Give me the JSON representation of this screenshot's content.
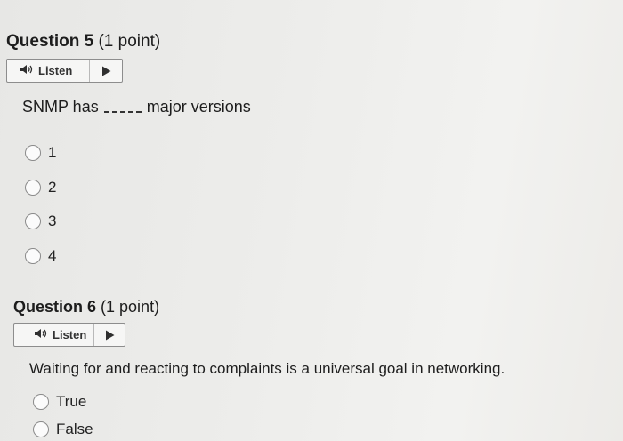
{
  "questions": [
    {
      "number_label": "Question 5",
      "points_label": "(1 point)",
      "listen_label": "Listen",
      "prompt_before": "SNMP has",
      "prompt_after": "major versions",
      "options": [
        "1",
        "2",
        "3",
        "4"
      ]
    },
    {
      "number_label": "Question 6",
      "points_label": "(1 point)",
      "listen_label": "Listen",
      "prompt": "Waiting for and reacting to complaints is a universal goal in networking.",
      "options": [
        "True",
        "False"
      ]
    }
  ],
  "icons": {
    "speaker": "speaker-icon",
    "play": "play-icon",
    "radio": "radio-button"
  },
  "colors": {
    "text": "#1d1d1d",
    "border": "#8d8d8d",
    "icon": "#2f2f2f"
  }
}
